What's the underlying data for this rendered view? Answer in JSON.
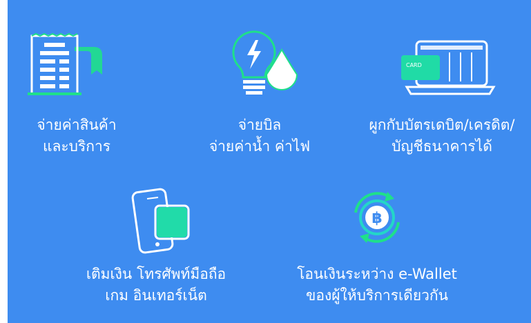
{
  "colors": {
    "background": "#3e8cf0",
    "icon_outline": "#ffffff",
    "accent_green": "#1fe08a",
    "accent_teal": "#23d6c8"
  },
  "features": [
    {
      "icon": "receipt-icon",
      "line1": "จ่ายค่าสินค้า",
      "line2": "และบริการ"
    },
    {
      "icon": "bulb-water-drop-icon",
      "line1": "จ่ายบิล",
      "line2": "จ่ายค่าน้ำ ค่าไฟ"
    },
    {
      "icon": "card-laptop-icon",
      "card_text": "CARD",
      "line1": "ผูกกับบัตรเดบิต/เครดิต/",
      "line2": "บัญชีธนาคารได้"
    },
    {
      "icon": "phone-topup-icon",
      "line1": "เติมเงิน โทรศัพท์มือถือ",
      "line2": "เกม อินเทอร์เน็ต"
    },
    {
      "icon": "baht-transfer-icon",
      "line1": "โอนเงินระหว่าง e-Wallet",
      "line2": "ของผู้ให้บริการเดียวกัน"
    }
  ]
}
